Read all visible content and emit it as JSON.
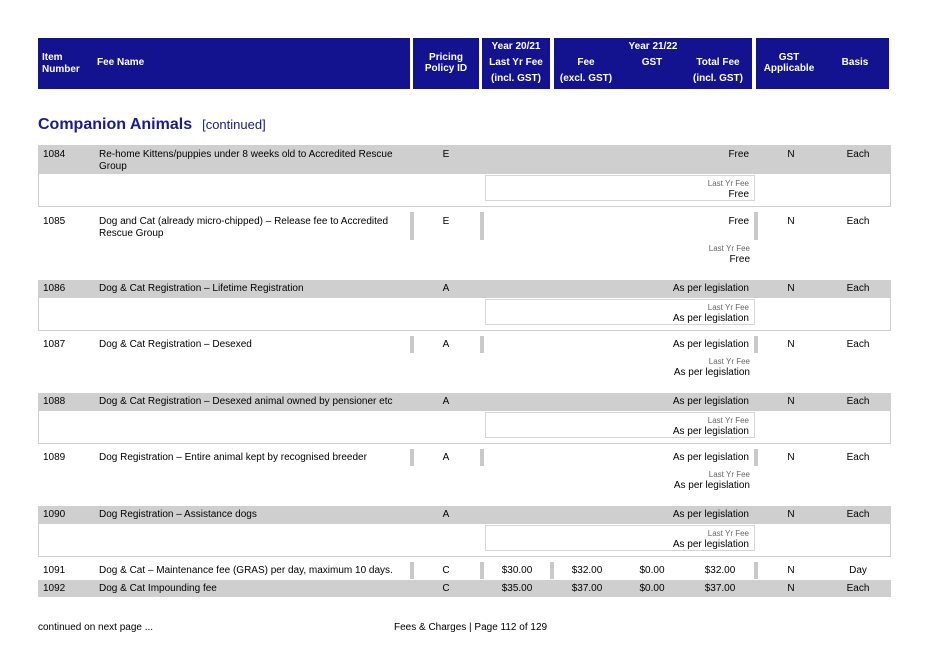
{
  "header": {
    "item_number": [
      "Item",
      "Number"
    ],
    "fee_name": "Fee Name",
    "pricing_policy": [
      "Pricing",
      "Policy ID"
    ],
    "year_2021": "Year 20/21",
    "last_yr_fee": [
      "Last Yr Fee",
      "(incl. GST)"
    ],
    "year_2122": "Year 21/22",
    "fee": [
      "Fee",
      "(excl. GST)"
    ],
    "gst": "GST",
    "total_fee": [
      "Total Fee",
      "(incl. GST)"
    ],
    "gst_applicable": [
      "GST",
      "Applicable"
    ],
    "basis": "Basis"
  },
  "section": {
    "title": "Companion Animals",
    "continued": "[continued]"
  },
  "last_yr_label": "Last Yr Fee",
  "rows": [
    {
      "item": "1084",
      "name": "Re-home Kittens/puppies under 8 weeks old to Accredited Rescue Group",
      "policy": "E",
      "total": "Free",
      "last_yr": "Free",
      "gst_app": "N",
      "basis": "Each"
    },
    {
      "item": "1085",
      "name": "Dog and Cat (already micro-chipped)  – Release fee to Accredited Rescue Group",
      "policy": "E",
      "total": "Free",
      "last_yr": "Free",
      "gst_app": "N",
      "basis": "Each"
    },
    {
      "item": "1086",
      "name": "Dog & Cat Registration – Lifetime Registration",
      "policy": "A",
      "total": "As per legislation",
      "last_yr": "As per legislation",
      "gst_app": "N",
      "basis": "Each"
    },
    {
      "item": "1087",
      "name": "Dog & Cat Registration – Desexed",
      "policy": "A",
      "total": "As per legislation",
      "last_yr": "As per legislation",
      "gst_app": "N",
      "basis": "Each"
    },
    {
      "item": "1088",
      "name": "Dog & Cat Registration – Desexed animal owned by pensioner etc",
      "policy": "A",
      "total": "As per legislation",
      "last_yr": "As per legislation",
      "gst_app": "N",
      "basis": "Each"
    },
    {
      "item": "1089",
      "name": "Dog Registration – Entire animal kept by recognised breeder",
      "policy": "A",
      "total": "As per legislation",
      "last_yr": "As per legislation",
      "gst_app": "N",
      "basis": "Each"
    },
    {
      "item": "1090",
      "name": "Dog Registration – Assistance dogs",
      "policy": "A",
      "total": "As per legislation",
      "last_yr": "As per legislation",
      "gst_app": "N",
      "basis": "Each"
    },
    {
      "item": "1091",
      "name": "Dog & Cat – Maintenance fee (GRAS) per day, maximum 10 days.",
      "policy": "C",
      "last_yr": "$30.00",
      "fee": "$32.00",
      "gst": "$0.00",
      "total": "$32.00",
      "gst_app": "N",
      "basis": "Day"
    },
    {
      "item": "1092",
      "name": "Dog & Cat Impounding fee",
      "policy": "C",
      "last_yr": "$35.00",
      "fee": "$37.00",
      "gst": "$0.00",
      "total": "$37.00",
      "gst_app": "N",
      "basis": "Each"
    }
  ],
  "footer": {
    "left": "continued on next page ...",
    "center": "Fees & Charges | Page 112 of 129"
  }
}
